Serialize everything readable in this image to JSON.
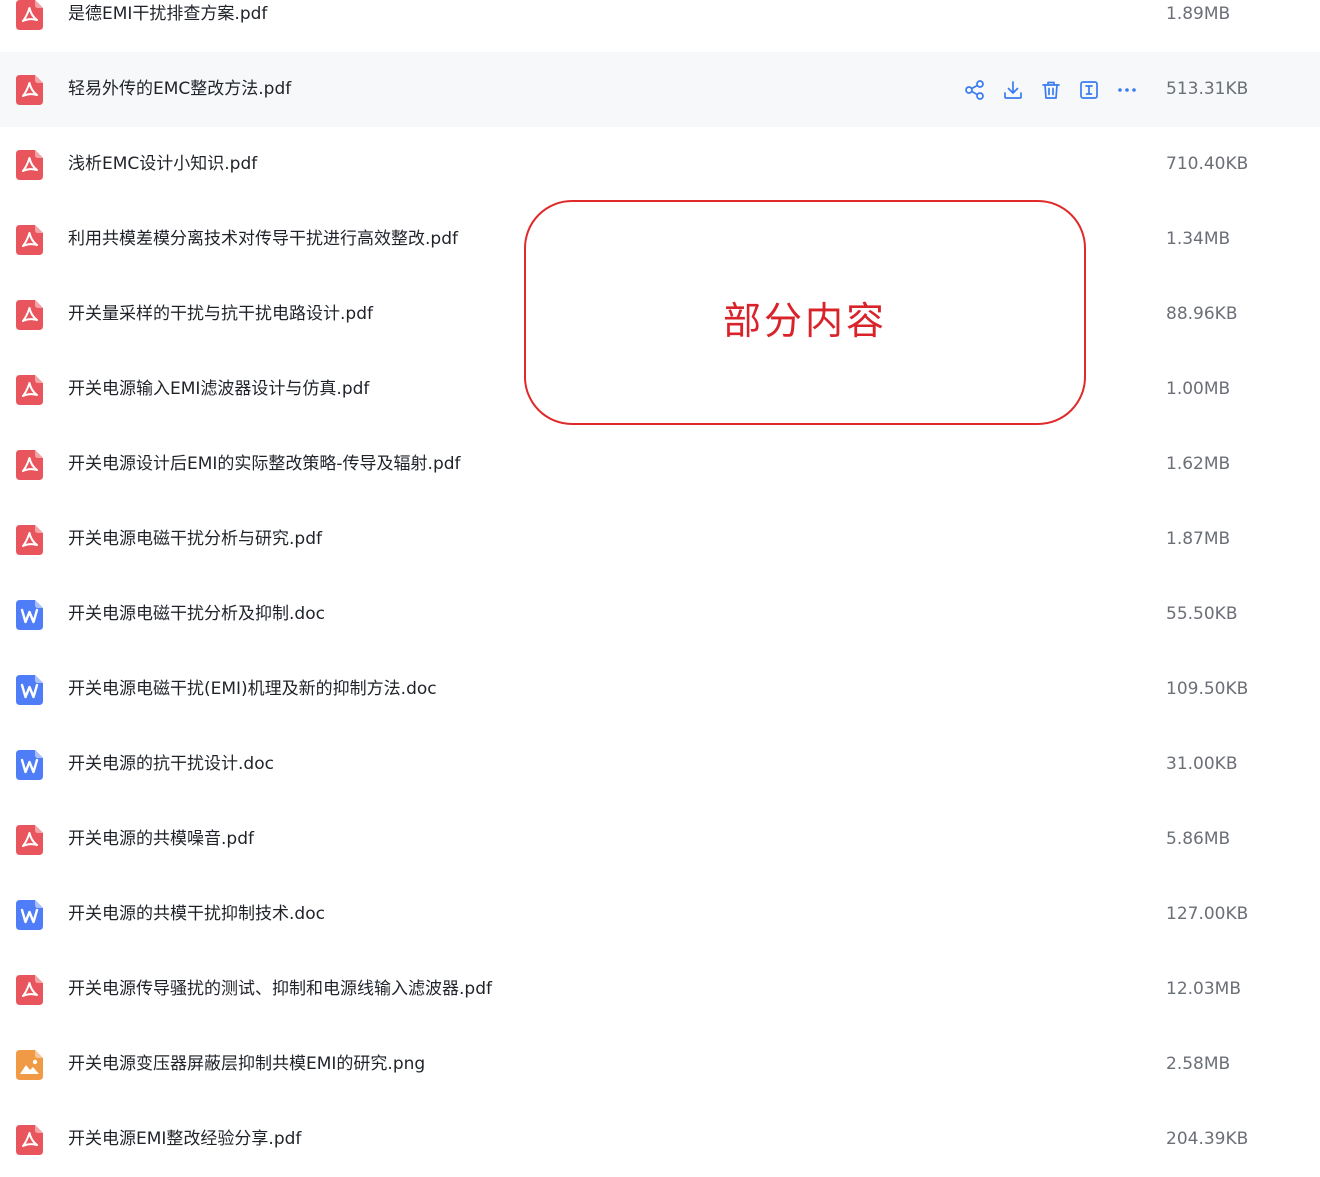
{
  "files": [
    {
      "name": "是德EMI干扰排查方案.pdf",
      "size": "1.89MB",
      "icon": "pdf-icon"
    },
    {
      "name": "轻易外传的EMC整改方法.pdf",
      "size": "513.31KB",
      "icon": "pdf-icon",
      "hovered": true
    },
    {
      "name": "浅析EMC设计小知识.pdf",
      "size": "710.40KB",
      "icon": "pdf-icon"
    },
    {
      "name": "利用共模差模分离技术对传导干扰进行高效整改.pdf",
      "size": "1.34MB",
      "icon": "pdf-icon"
    },
    {
      "name": "开关量采样的干扰与抗干扰电路设计.pdf",
      "size": "88.96KB",
      "icon": "pdf-icon"
    },
    {
      "name": "开关电源输入EMI滤波器设计与仿真.pdf",
      "size": "1.00MB",
      "icon": "pdf-icon"
    },
    {
      "name": "开关电源设计后EMI的实际整改策略-传导及辐射.pdf",
      "size": "1.62MB",
      "icon": "pdf-icon"
    },
    {
      "name": "开关电源电磁干扰分析与研究.pdf",
      "size": "1.87MB",
      "icon": "pdf-icon"
    },
    {
      "name": "开关电源电磁干扰分析及抑制.doc",
      "size": "55.50KB",
      "icon": "word-icon"
    },
    {
      "name": "开关电源电磁干扰(EMI)机理及新的抑制方法.doc",
      "size": "109.50KB",
      "icon": "word-icon"
    },
    {
      "name": "开关电源的抗干扰设计.doc",
      "size": "31.00KB",
      "icon": "word-icon"
    },
    {
      "name": "开关电源的共模噪音.pdf",
      "size": "5.86MB",
      "icon": "pdf-icon"
    },
    {
      "name": "开关电源的共模干扰抑制技术.doc",
      "size": "127.00KB",
      "icon": "word-icon"
    },
    {
      "name": "开关电源传导骚扰的测试、抑制和电源线输入滤波器.pdf",
      "size": "12.03MB",
      "icon": "pdf-icon"
    },
    {
      "name": "开关电源变压器屏蔽层抑制共模EMI的研究.png",
      "size": "2.58MB",
      "icon": "image-icon"
    },
    {
      "name": "开关电源EMI整改经验分享.pdf",
      "size": "204.39KB",
      "icon": "pdf-icon"
    }
  ],
  "row_actions": [
    "share-icon",
    "download-icon",
    "delete-icon",
    "rename-icon",
    "more-icon"
  ],
  "overlay": {
    "text": "部分内容"
  },
  "colors": {
    "pdf": "#e8555c",
    "word": "#4f7cf7",
    "image": "#f09a45",
    "action": "#3a7bf0",
    "overlay": "#d9232a"
  }
}
